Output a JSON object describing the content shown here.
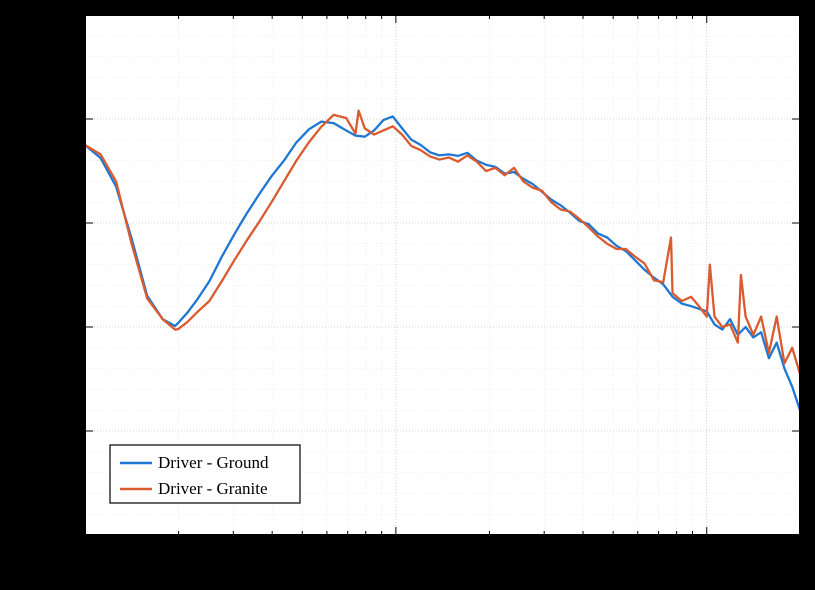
{
  "chart_data": {
    "type": "line",
    "title": "",
    "xlabel": "",
    "ylabel": "",
    "xscale": "log",
    "yscale": "linear",
    "xlim_log10": [
      0,
      2.3
    ],
    "ylim": [
      0,
      100
    ],
    "y_gridlines": [
      0,
      20,
      40,
      60,
      80,
      100
    ],
    "x_decade_anchors_log10": [
      0,
      1,
      2
    ],
    "legend_position": "lower-left",
    "colors": {
      "series1": "#1f77d4",
      "series2": "#d95b2e",
      "axis": "#000000",
      "grid_major": "#bfbfbf",
      "grid_minor": "#e0e0e0",
      "plot_bg": "#ffffff",
      "legend_frame": "#000000"
    },
    "series": [
      {
        "name": "Driver - Ground",
        "display": "Driver - Ground",
        "color": "#1f77d4",
        "x_log10": [
          0.0,
          0.05,
          0.1,
          0.15,
          0.2,
          0.25,
          0.29,
          0.3,
          0.33,
          0.36,
          0.4,
          0.44,
          0.48,
          0.52,
          0.56,
          0.6,
          0.64,
          0.68,
          0.72,
          0.76,
          0.8,
          0.84,
          0.87,
          0.9,
          0.93,
          0.96,
          0.99,
          1.02,
          1.05,
          1.08,
          1.11,
          1.14,
          1.17,
          1.2,
          1.23,
          1.26,
          1.29,
          1.32,
          1.35,
          1.38,
          1.41,
          1.44,
          1.47,
          1.5,
          1.53,
          1.56,
          1.59,
          1.62,
          1.65,
          1.68,
          1.71,
          1.74,
          1.77,
          1.8,
          1.83,
          1.86,
          1.89,
          1.92,
          1.95,
          1.975,
          2.0,
          2.025,
          2.05,
          2.075,
          2.1,
          2.125,
          2.15,
          2.175,
          2.2,
          2.225,
          2.25,
          2.275,
          2.3
        ],
        "y": [
          75.0,
          72.5,
          67.0,
          57.0,
          46.0,
          41.5,
          40.2,
          40.8,
          42.8,
          45.2,
          48.8,
          53.5,
          57.8,
          61.8,
          65.5,
          69.0,
          72.0,
          75.5,
          78.0,
          79.5,
          79.2,
          77.8,
          76.8,
          76.6,
          77.8,
          79.8,
          80.5,
          78.2,
          76.0,
          75.0,
          73.6,
          73.0,
          73.2,
          72.9,
          73.5,
          72.0,
          71.2,
          70.8,
          69.5,
          69.8,
          68.5,
          67.5,
          66.0,
          64.5,
          63.4,
          62.0,
          60.4,
          59.8,
          58.0,
          57.2,
          55.6,
          54.6,
          52.8,
          51.0,
          49.5,
          48.2,
          45.8,
          44.5,
          44.0,
          43.5,
          43.0,
          40.5,
          39.5,
          41.5,
          38.5,
          40.0,
          38.0,
          39.0,
          34.0,
          37.0,
          32.0,
          28.5,
          24.0
        ]
      },
      {
        "name": "Driver - Granite",
        "display": "Driver - Granite",
        "color": "#d95b2e",
        "x_log10": [
          0.0,
          0.05,
          0.1,
          0.15,
          0.2,
          0.25,
          0.29,
          0.3,
          0.33,
          0.36,
          0.4,
          0.44,
          0.48,
          0.52,
          0.56,
          0.6,
          0.64,
          0.68,
          0.72,
          0.76,
          0.8,
          0.84,
          0.87,
          0.88,
          0.9,
          0.93,
          0.96,
          0.99,
          1.02,
          1.05,
          1.08,
          1.11,
          1.14,
          1.17,
          1.2,
          1.23,
          1.26,
          1.29,
          1.32,
          1.35,
          1.38,
          1.41,
          1.44,
          1.47,
          1.5,
          1.53,
          1.56,
          1.59,
          1.62,
          1.65,
          1.68,
          1.71,
          1.74,
          1.77,
          1.8,
          1.83,
          1.86,
          1.885,
          1.89,
          1.92,
          1.95,
          1.975,
          2.0,
          2.01,
          2.025,
          2.05,
          2.075,
          2.1,
          2.11,
          2.125,
          2.15,
          2.175,
          2.2,
          2.225,
          2.25,
          2.275,
          2.3
        ],
        "y": [
          75.0,
          73.2,
          68.0,
          56.0,
          45.5,
          41.5,
          39.5,
          39.6,
          41.0,
          42.8,
          45.0,
          48.8,
          52.8,
          56.6,
          60.2,
          64.0,
          68.0,
          72.0,
          75.5,
          78.5,
          80.8,
          80.2,
          77.2,
          81.6,
          78.2,
          77.0,
          77.8,
          78.6,
          77.0,
          74.8,
          74.0,
          72.8,
          72.2,
          72.6,
          71.8,
          73.0,
          71.8,
          70.0,
          70.6,
          69.2,
          70.6,
          68.0,
          66.8,
          66.2,
          64.0,
          62.6,
          62.2,
          60.8,
          59.2,
          57.4,
          56.0,
          55.0,
          55.0,
          53.5,
          52.2,
          49.0,
          48.6,
          57.2,
          46.5,
          45.0,
          45.8,
          44.0,
          42.0,
          52.0,
          42.0,
          40.0,
          40.5,
          37.0,
          50.0,
          42.0,
          38.5,
          42.0,
          35.0,
          42.0,
          33.0,
          36.0,
          31.0
        ]
      }
    ]
  },
  "legend": {
    "items": [
      {
        "label": "Driver - Ground",
        "color": "#1f77d4"
      },
      {
        "label": "Driver - Granite",
        "color": "#d95b2e"
      }
    ]
  }
}
